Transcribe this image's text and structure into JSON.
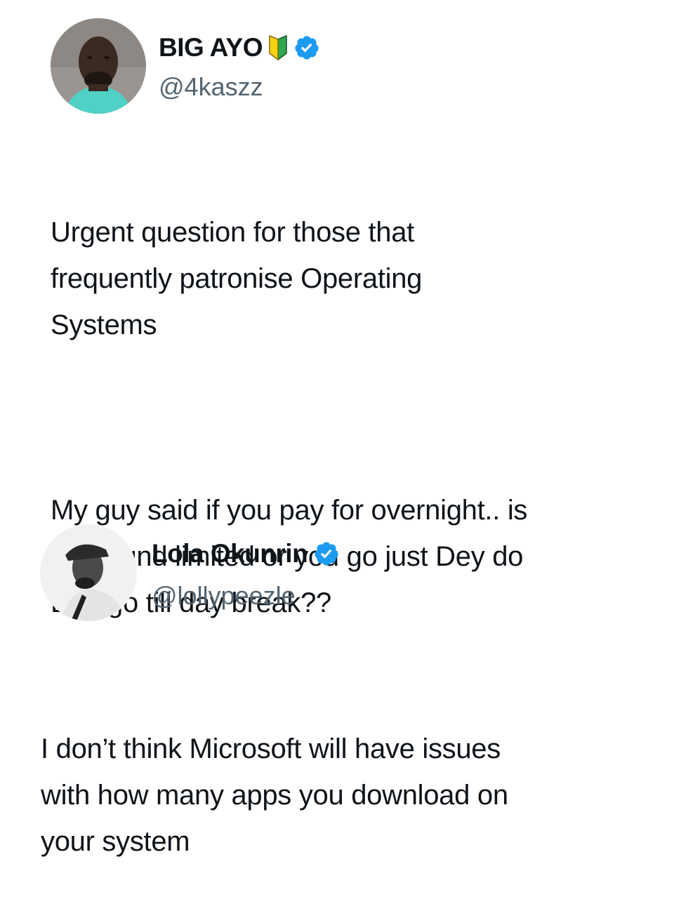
{
  "tweets": [
    {
      "display_name": "BIG AYO",
      "handle": "@4kaszz",
      "name_emoji": "beginner-symbol-icon",
      "verified": true,
      "paragraphs": [
        "Urgent question for those that\nfrequently patronise Operating\nSystems",
        "My guy said if you pay for overnight.. is\nthe round limited or you go just Dey do\nDey go till day break??"
      ]
    },
    {
      "display_name": "Lola Okunrin",
      "handle": "@lollypeezle",
      "verified": true,
      "paragraphs": [
        "I don’t think Microsoft will have issues\nwith how many apps you download on\nyour system"
      ]
    }
  ],
  "colors": {
    "verified_badge": "#1d9bf0",
    "handle_text": "#536471",
    "body_text": "#0f1419"
  }
}
